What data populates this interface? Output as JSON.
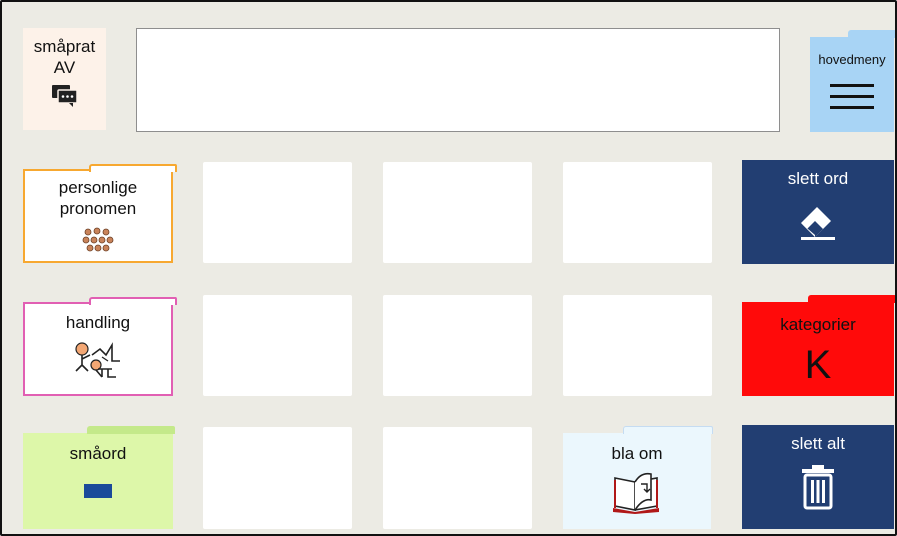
{
  "colors": {
    "background": "#ecebe4",
    "navy": "#223e72",
    "red": "#ff0a0a",
    "orange": "#f7a830",
    "pink": "#e15fb3",
    "light_green": "#ddf7a9",
    "light_blue": "#a8d4f5"
  },
  "top": {
    "smaprat": {
      "line1": "småprat",
      "line2": "AV",
      "icon": "speech-bubbles-icon"
    },
    "message_bar": {
      "value": ""
    },
    "hovedmeny": {
      "label": "hovedmeny",
      "icon": "menu-icon"
    }
  },
  "grid": {
    "personlige": {
      "line1": "personlige",
      "line2": "pronomen",
      "icon": "people-icon"
    },
    "handling": {
      "label": "handling",
      "icon": "action-figure-icon"
    },
    "smaord": {
      "label": "småord",
      "icon": "dash-icon"
    },
    "bla_om": {
      "label": "bla om",
      "icon": "book-page-turn-icon"
    },
    "slett_ord": {
      "label": "slett ord",
      "icon": "eraser-icon"
    },
    "kategorier": {
      "label": "kategorier",
      "letter": "K"
    },
    "slett_alt": {
      "label": "slett alt",
      "icon": "trash-icon"
    }
  }
}
